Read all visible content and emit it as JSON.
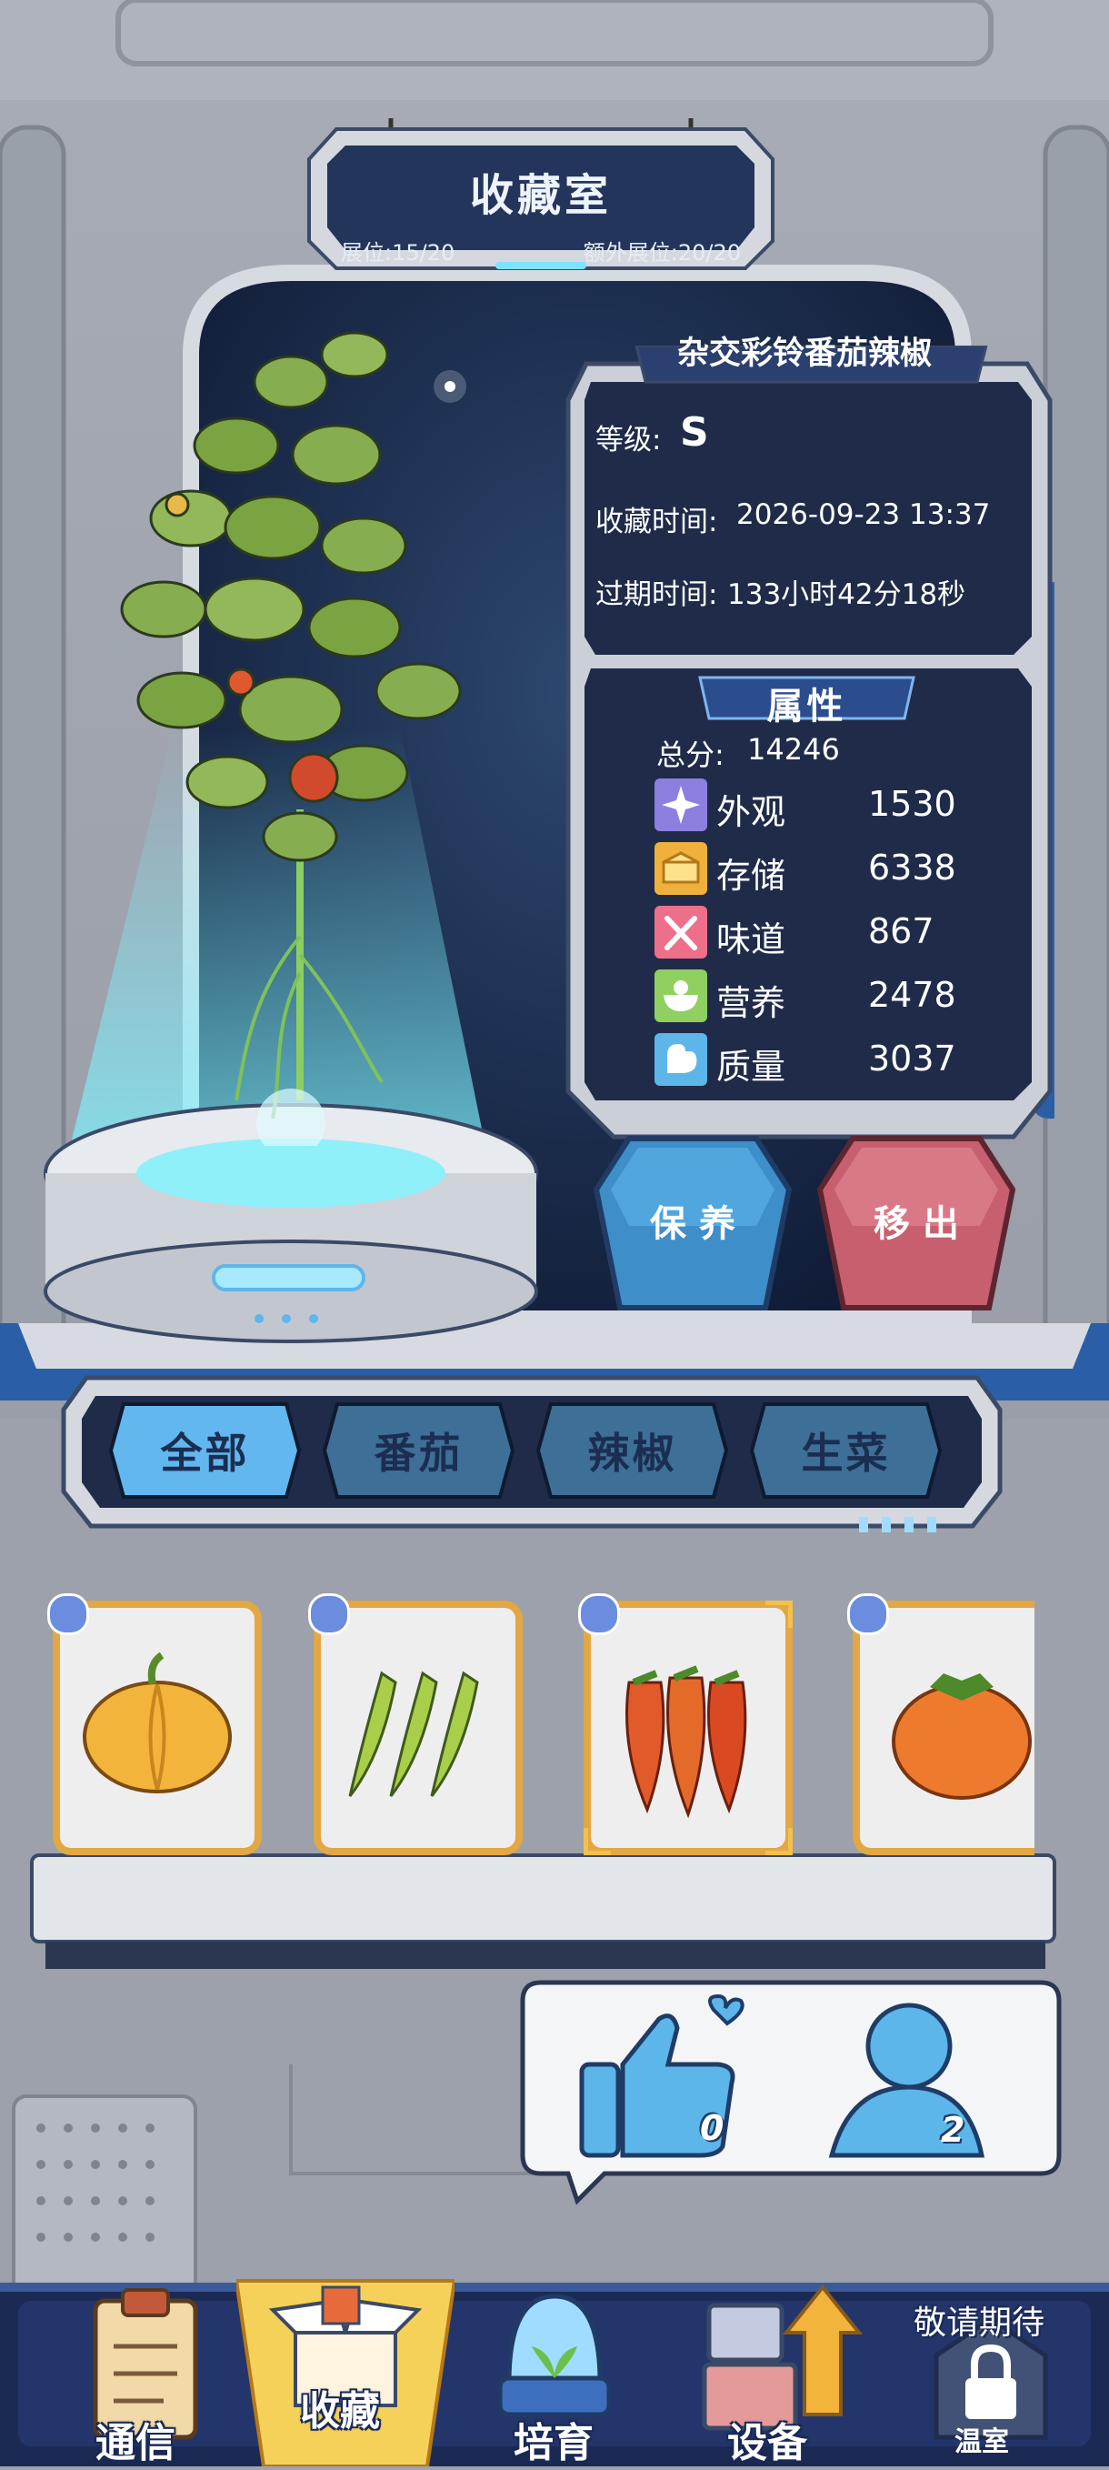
{
  "header": {
    "title": "收藏室",
    "slots_label": "展位:15/20",
    "extra_slots_label": "额外展位:20/20"
  },
  "plant": {
    "name": "杂交彩铃番茄辣椒",
    "grade_label": "等级:",
    "grade_value": "S",
    "collect_time_label": "收藏时间:",
    "collect_time_value": "2026-09-23 13:37",
    "expire_label": "过期时间:",
    "expire_value": "133小时42分18秒"
  },
  "attributes": {
    "title": "属性",
    "total_label": "总分:",
    "total_value": "14246",
    "items": [
      {
        "icon": "sparkle-icon",
        "name": "外观",
        "value": "1530",
        "color": "#8c7fe0"
      },
      {
        "icon": "storage-box-icon",
        "name": "存储",
        "value": "6338",
        "color": "#f0b13c"
      },
      {
        "icon": "utensils-icon",
        "name": "味道",
        "value": "867",
        "color": "#ee6f8a"
      },
      {
        "icon": "nutrition-icon",
        "name": "营养",
        "value": "2478",
        "color": "#8fd060"
      },
      {
        "icon": "muscle-icon",
        "name": "质量",
        "value": "3037",
        "color": "#5cb6ea"
      }
    ]
  },
  "actions": {
    "maintain_label": "保 养",
    "remove_label": "移 出"
  },
  "tabs": [
    {
      "label": "全部",
      "active": true
    },
    {
      "label": "番茄",
      "active": false
    },
    {
      "label": "辣椒",
      "active": false
    },
    {
      "label": "生菜",
      "active": false
    }
  ],
  "items": [
    {
      "icon": "pumpkin-icon"
    },
    {
      "icon": "okra-icon"
    },
    {
      "icon": "carrot-chili-icon",
      "selected": true
    },
    {
      "icon": "persimmon-icon"
    }
  ],
  "social": {
    "likes": "0",
    "visitors": "2"
  },
  "nav": {
    "items": [
      {
        "label": "通信",
        "icon": "clipboard-icon"
      },
      {
        "label": "收藏",
        "icon": "collection-box-icon",
        "active": true
      },
      {
        "label": "培育",
        "icon": "terrarium-icon"
      },
      {
        "label": "设备",
        "icon": "device-upgrade-icon"
      },
      {
        "label": "温室",
        "icon": "greenhouse-lock-icon",
        "locked": true
      }
    ],
    "coming_soon": "敬请期待"
  },
  "colors": {
    "panel_dark": "#1f2b49",
    "accent_blue": "#5fb6ec",
    "button_blue": "#3e8ec9",
    "button_red": "#c85f6e",
    "metal": "#c9ced6"
  }
}
